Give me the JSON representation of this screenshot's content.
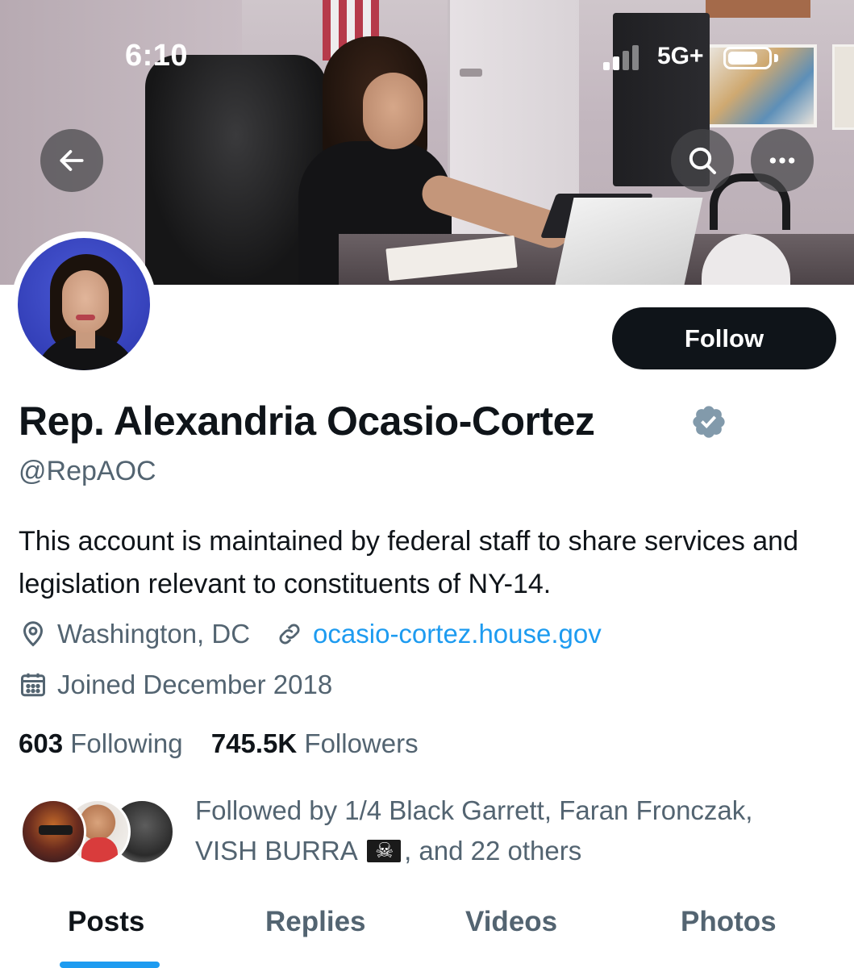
{
  "status_bar": {
    "time": "6:10",
    "network": "5G+",
    "battery_level": 0.75,
    "signal_bars": 2
  },
  "header": {
    "back_icon": "arrow-left-icon",
    "search_icon": "search-icon",
    "more_icon": "more-horizontal-icon"
  },
  "profile": {
    "name": "Rep. Alexandria Ocasio-Cortez",
    "verified_icon": "verified-badge-icon",
    "verified_color": "#829aab",
    "handle": "@RepAOC",
    "bio": "This account is maintained by federal staff to share services and legislation relevant to constituents of NY-14.",
    "location": "Washington, DC",
    "website": "ocasio-cortez.house.gov",
    "joined": "Joined December 2018",
    "follow_label": "Follow"
  },
  "stats": {
    "following_count": "603",
    "following_label": "Following",
    "followers_count": "745.5K",
    "followers_label": "Followers"
  },
  "followed_by": {
    "prefix": "Followed by 1/4 Black Garrett, Faran Fronczak,",
    "line2_name": "VISH BURRA",
    "flag_emoji": "🏴‍☠️",
    "suffix": ", and 22 others"
  },
  "tabs": [
    {
      "label": "Posts",
      "active": true
    },
    {
      "label": "Replies",
      "active": false
    },
    {
      "label": "Videos",
      "active": false
    },
    {
      "label": "Photos",
      "active": false
    }
  ],
  "colors": {
    "accent": "#1d9bf0",
    "text_primary": "#0f1419",
    "text_secondary": "#536471",
    "button_dark": "#0f1419"
  }
}
